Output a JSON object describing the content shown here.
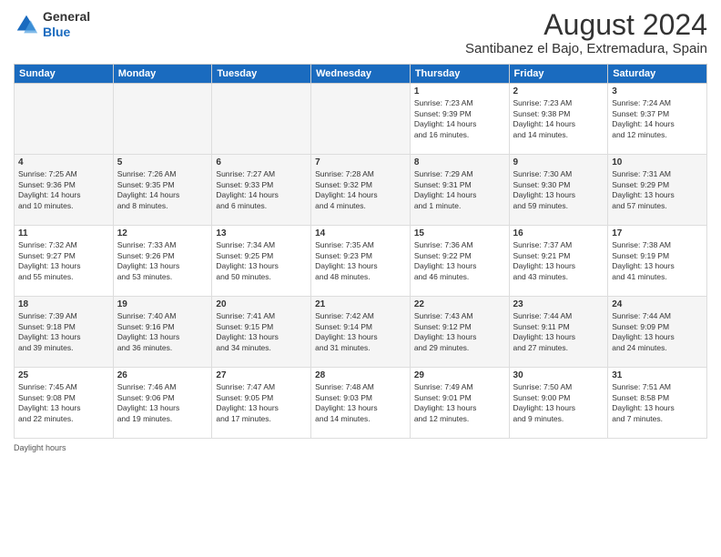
{
  "header": {
    "logo_line1": "General",
    "logo_line2": "Blue",
    "month_year": "August 2024",
    "location": "Santibanez el Bajo, Extremadura, Spain"
  },
  "days_of_week": [
    "Sunday",
    "Monday",
    "Tuesday",
    "Wednesday",
    "Thursday",
    "Friday",
    "Saturday"
  ],
  "footer": {
    "daylight_label": "Daylight hours"
  },
  "weeks": [
    {
      "days": [
        {
          "num": "",
          "info": ""
        },
        {
          "num": "",
          "info": ""
        },
        {
          "num": "",
          "info": ""
        },
        {
          "num": "",
          "info": ""
        },
        {
          "num": "1",
          "info": "Sunrise: 7:23 AM\nSunset: 9:39 PM\nDaylight: 14 hours\nand 16 minutes."
        },
        {
          "num": "2",
          "info": "Sunrise: 7:23 AM\nSunset: 9:38 PM\nDaylight: 14 hours\nand 14 minutes."
        },
        {
          "num": "3",
          "info": "Sunrise: 7:24 AM\nSunset: 9:37 PM\nDaylight: 14 hours\nand 12 minutes."
        }
      ]
    },
    {
      "days": [
        {
          "num": "4",
          "info": "Sunrise: 7:25 AM\nSunset: 9:36 PM\nDaylight: 14 hours\nand 10 minutes."
        },
        {
          "num": "5",
          "info": "Sunrise: 7:26 AM\nSunset: 9:35 PM\nDaylight: 14 hours\nand 8 minutes."
        },
        {
          "num": "6",
          "info": "Sunrise: 7:27 AM\nSunset: 9:33 PM\nDaylight: 14 hours\nand 6 minutes."
        },
        {
          "num": "7",
          "info": "Sunrise: 7:28 AM\nSunset: 9:32 PM\nDaylight: 14 hours\nand 4 minutes."
        },
        {
          "num": "8",
          "info": "Sunrise: 7:29 AM\nSunset: 9:31 PM\nDaylight: 14 hours\nand 1 minute."
        },
        {
          "num": "9",
          "info": "Sunrise: 7:30 AM\nSunset: 9:30 PM\nDaylight: 13 hours\nand 59 minutes."
        },
        {
          "num": "10",
          "info": "Sunrise: 7:31 AM\nSunset: 9:29 PM\nDaylight: 13 hours\nand 57 minutes."
        }
      ]
    },
    {
      "days": [
        {
          "num": "11",
          "info": "Sunrise: 7:32 AM\nSunset: 9:27 PM\nDaylight: 13 hours\nand 55 minutes."
        },
        {
          "num": "12",
          "info": "Sunrise: 7:33 AM\nSunset: 9:26 PM\nDaylight: 13 hours\nand 53 minutes."
        },
        {
          "num": "13",
          "info": "Sunrise: 7:34 AM\nSunset: 9:25 PM\nDaylight: 13 hours\nand 50 minutes."
        },
        {
          "num": "14",
          "info": "Sunrise: 7:35 AM\nSunset: 9:23 PM\nDaylight: 13 hours\nand 48 minutes."
        },
        {
          "num": "15",
          "info": "Sunrise: 7:36 AM\nSunset: 9:22 PM\nDaylight: 13 hours\nand 46 minutes."
        },
        {
          "num": "16",
          "info": "Sunrise: 7:37 AM\nSunset: 9:21 PM\nDaylight: 13 hours\nand 43 minutes."
        },
        {
          "num": "17",
          "info": "Sunrise: 7:38 AM\nSunset: 9:19 PM\nDaylight: 13 hours\nand 41 minutes."
        }
      ]
    },
    {
      "days": [
        {
          "num": "18",
          "info": "Sunrise: 7:39 AM\nSunset: 9:18 PM\nDaylight: 13 hours\nand 39 minutes."
        },
        {
          "num": "19",
          "info": "Sunrise: 7:40 AM\nSunset: 9:16 PM\nDaylight: 13 hours\nand 36 minutes."
        },
        {
          "num": "20",
          "info": "Sunrise: 7:41 AM\nSunset: 9:15 PM\nDaylight: 13 hours\nand 34 minutes."
        },
        {
          "num": "21",
          "info": "Sunrise: 7:42 AM\nSunset: 9:14 PM\nDaylight: 13 hours\nand 31 minutes."
        },
        {
          "num": "22",
          "info": "Sunrise: 7:43 AM\nSunset: 9:12 PM\nDaylight: 13 hours\nand 29 minutes."
        },
        {
          "num": "23",
          "info": "Sunrise: 7:44 AM\nSunset: 9:11 PM\nDaylight: 13 hours\nand 27 minutes."
        },
        {
          "num": "24",
          "info": "Sunrise: 7:44 AM\nSunset: 9:09 PM\nDaylight: 13 hours\nand 24 minutes."
        }
      ]
    },
    {
      "days": [
        {
          "num": "25",
          "info": "Sunrise: 7:45 AM\nSunset: 9:08 PM\nDaylight: 13 hours\nand 22 minutes."
        },
        {
          "num": "26",
          "info": "Sunrise: 7:46 AM\nSunset: 9:06 PM\nDaylight: 13 hours\nand 19 minutes."
        },
        {
          "num": "27",
          "info": "Sunrise: 7:47 AM\nSunset: 9:05 PM\nDaylight: 13 hours\nand 17 minutes."
        },
        {
          "num": "28",
          "info": "Sunrise: 7:48 AM\nSunset: 9:03 PM\nDaylight: 13 hours\nand 14 minutes."
        },
        {
          "num": "29",
          "info": "Sunrise: 7:49 AM\nSunset: 9:01 PM\nDaylight: 13 hours\nand 12 minutes."
        },
        {
          "num": "30",
          "info": "Sunrise: 7:50 AM\nSunset: 9:00 PM\nDaylight: 13 hours\nand 9 minutes."
        },
        {
          "num": "31",
          "info": "Sunrise: 7:51 AM\nSunset: 8:58 PM\nDaylight: 13 hours\nand 7 minutes."
        }
      ]
    }
  ]
}
